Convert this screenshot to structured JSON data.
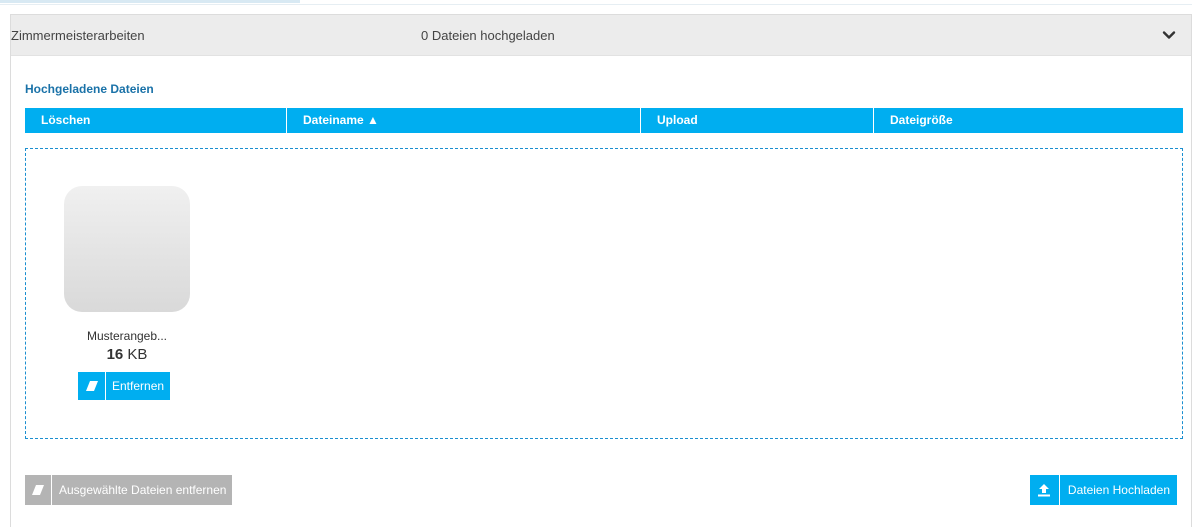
{
  "accordion": {
    "title": "Zimmermeisterarbeiten",
    "status": "0 Dateien hochgeladen",
    "toggle_icon": "chevron-down-icon"
  },
  "uploaded_files": {
    "heading": "Hochgeladene Dateien",
    "columns": [
      "Löschen",
      "Dateiname ▲",
      "Upload",
      "Dateigröße"
    ]
  },
  "dropzone": {
    "files": [
      {
        "name": "Musterangeb...",
        "size_value": "16",
        "size_unit": "KB",
        "remove_label": "Entfernen",
        "remove_icon": "eraser-icon"
      }
    ]
  },
  "actions": {
    "remove_selected_label": "Ausgewählte Dateien entfernen",
    "remove_selected_icon": "eraser-icon",
    "upload_label": "Dateien Hochladen",
    "upload_icon": "upload-icon"
  },
  "colors": {
    "accent": "#00aef0",
    "heading": "#1a72a8",
    "disabled": "#b4b4b4",
    "header_bg": "#ececec"
  }
}
